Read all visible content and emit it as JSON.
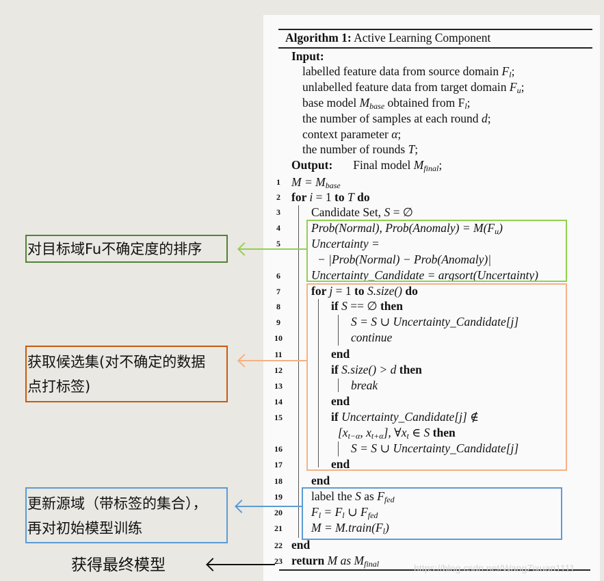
{
  "algorithm": {
    "title_label": "Algorithm 1:",
    "title_text": "Active Learning Component",
    "input_label": "Input:",
    "inputs": [
      {
        "text": "labelled feature data from source domain ",
        "math": "F",
        "sub": "l",
        "tail": ";"
      },
      {
        "text": "unlabelled feature data from target domain ",
        "math": "F",
        "sub": "u",
        "tail": ";"
      },
      {
        "text": "base model ",
        "math": "M",
        "sub": "base",
        "tail": " obtained from F",
        "tail_sub": "l",
        "end": ";"
      },
      {
        "text": "the number of samples at each round ",
        "math": "d",
        "tail": ";"
      },
      {
        "text": "context parameter ",
        "math": "α",
        "tail": ";"
      },
      {
        "text": "the number of rounds ",
        "math": "T",
        "tail": ";"
      }
    ],
    "output_label": "Output:",
    "output_text": "Final model ",
    "output_math": "M",
    "output_sub": "final",
    "output_end": ";",
    "lines": {
      "l1": {
        "num": "1",
        "a": "M = M",
        "sub": "base"
      },
      "l2": {
        "num": "2",
        "kw1": "for ",
        "a": "i",
        "b": " = 1 ",
        "kw2": "to ",
        "c": "T",
        "kw3": " do"
      },
      "l3": {
        "num": "3",
        "a": "Candidate Set, ",
        "b": "S",
        "c": " = ∅"
      },
      "l4": {
        "num": "4",
        "a": "Prob(Normal), Prob(Anomaly) = M(F",
        "sub": "u",
        "end": ")"
      },
      "l5": {
        "num": "5",
        "a": "Uncertainty ="
      },
      "l5b": {
        "a": "− |Prob(Normal) − Prob(Anomaly)|"
      },
      "l6": {
        "num": "6",
        "a": "Uncertainty_Candidate = argsort(Uncertainty)"
      },
      "l7": {
        "num": "7",
        "kw1": "for ",
        "a": "j",
        "b": " = 1 ",
        "kw2": "to ",
        "c": "S.size()",
        "kw3": " do"
      },
      "l8": {
        "num": "8",
        "kw1": "if ",
        "a": "S",
        "b": " == ∅ ",
        "kw2": "then"
      },
      "l9": {
        "num": "9",
        "a": "S = S ∪ Uncertainty_Candidate[j]"
      },
      "l10": {
        "num": "10",
        "a": "continue"
      },
      "l11": {
        "num": "11",
        "kw1": "end"
      },
      "l12": {
        "num": "12",
        "kw1": "if ",
        "a": " S.size() > d ",
        "kw2": "then"
      },
      "l13": {
        "num": "13",
        "a": "break"
      },
      "l14": {
        "num": "14",
        "kw1": "end"
      },
      "l15": {
        "num": "15",
        "kw1": "if ",
        "a": "Uncertainty_Candidate[j] ∉"
      },
      "l15b": {
        "a": "[x",
        "s1": "t−α",
        "b": ", x",
        "s2": "t+α",
        "c": "], ∀x",
        "s3": "t",
        "d": " ∈ S ",
        "kw": "then"
      },
      "l16": {
        "num": "16",
        "a": "S = S ∪ Uncertainty_Candidate[j]"
      },
      "l17": {
        "num": "17",
        "kw1": "end"
      },
      "l18": {
        "num": "18",
        "kw1": "end"
      },
      "l19": {
        "num": "19",
        "a": "label the ",
        "b": "S",
        "c": " as ",
        "d": "F",
        "sub": "fed"
      },
      "l20": {
        "num": "20",
        "a": "F",
        "s1": "l",
        "b": " = F",
        "s2": "l",
        "c": " ∪ F",
        "s3": "fed"
      },
      "l21": {
        "num": "21",
        "a": "M = M.train(F",
        "sub": "l",
        "end": ")"
      },
      "l22": {
        "num": "22",
        "kw1": "end"
      },
      "l23": {
        "num": "23",
        "kw1": "return ",
        "a": "M as M",
        "sub": "final"
      }
    }
  },
  "annotations": {
    "green": {
      "text": "对目标域Fu不确定度的排序",
      "color": "#538135",
      "frame_color": "#92d050"
    },
    "orange": {
      "line1": "获取候选集(对不确定的数据",
      "line2": "点打标签)",
      "color": "#c55a11",
      "frame_color": "#f4b183"
    },
    "blue": {
      "line1": "更新源域（带标签的集合），",
      "line2": "再对初始模型训练",
      "color": "#5b9bd5",
      "frame_color": "#5b9bd5"
    },
    "final": {
      "text": "获得最终模型",
      "color": "#111111"
    }
  },
  "watermark": "https://blog.csdn.net/WangZixuan1111"
}
